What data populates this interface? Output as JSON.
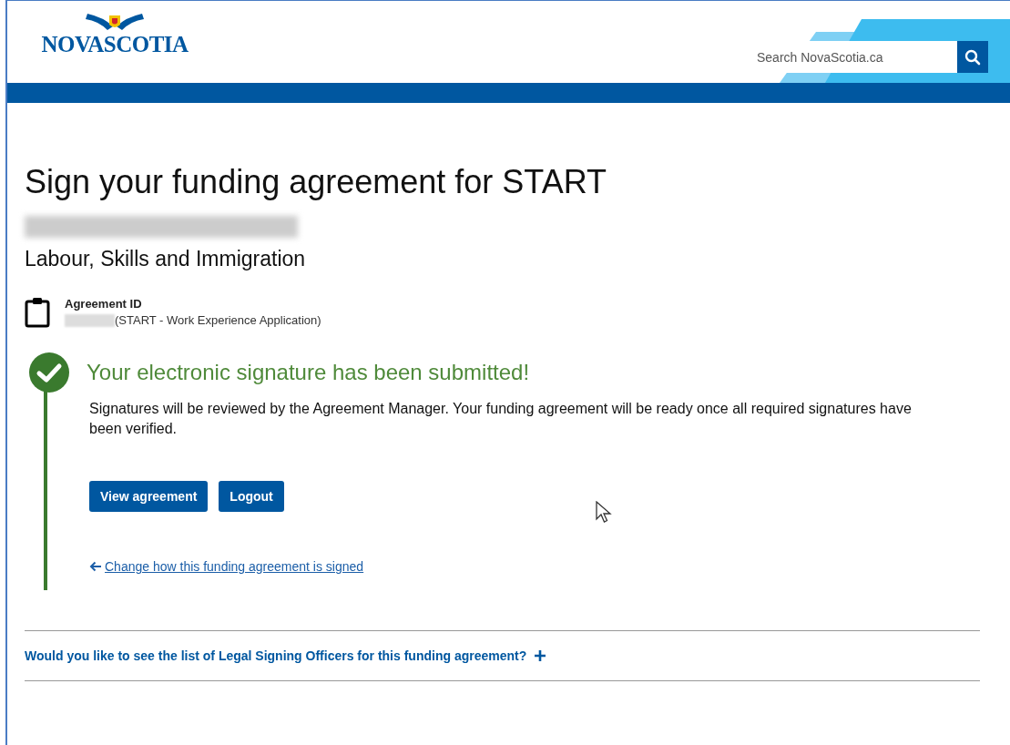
{
  "header": {
    "logo": "NOVASCOTIA",
    "search": {
      "placeholder": "Search NovaScotia.ca"
    }
  },
  "title": "Sign your funding agreement for START",
  "department": "Labour, Skills and Immigration",
  "agreement": {
    "label": "Agreement ID",
    "description": "(START - Work Experience Application)"
  },
  "status": {
    "heading": "Your electronic signature has been submitted!",
    "message": "Signatures will be reviewed by the Agreement Manager. Your funding agreement will be ready once all required signatures have been verified.",
    "buttons": [
      "View agreement",
      "Logout"
    ],
    "link": "Change how this funding agreement is signed"
  },
  "accordion": {
    "label": "Would you like to see the list of Legal Signing Officers for this funding agreement?",
    "expanded": false
  }
}
